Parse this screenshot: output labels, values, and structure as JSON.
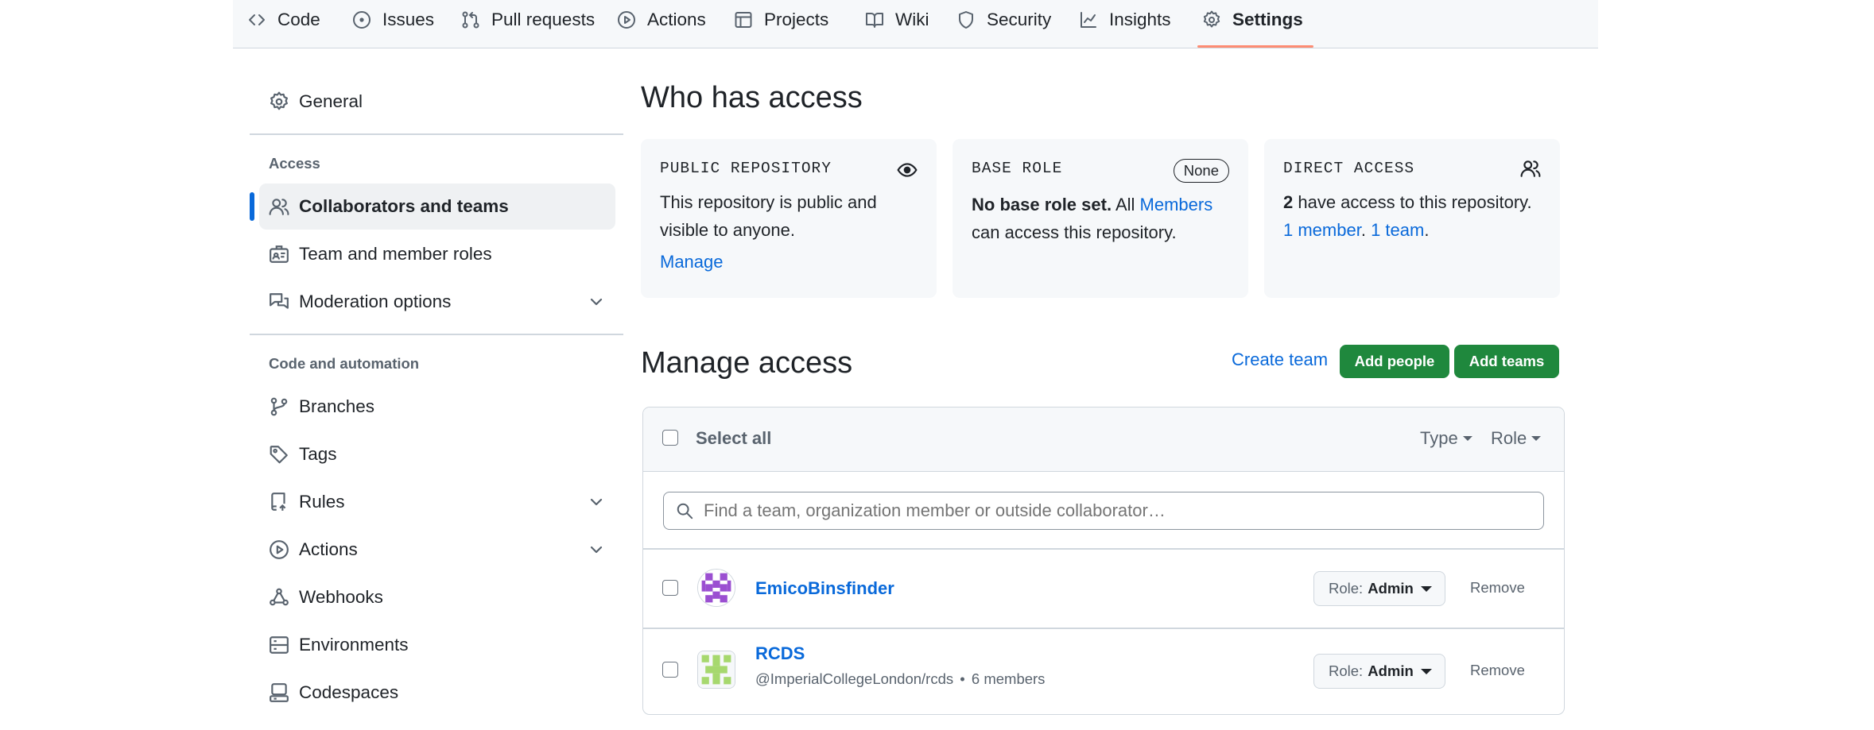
{
  "nav": {
    "items": [
      {
        "label": "Code",
        "icon": "code-icon"
      },
      {
        "label": "Issues",
        "icon": "issue-circle-icon"
      },
      {
        "label": "Pull requests",
        "icon": "pull-request-icon"
      },
      {
        "label": "Actions",
        "icon": "play-icon"
      },
      {
        "label": "Projects",
        "icon": "table-icon"
      },
      {
        "label": "Wiki",
        "icon": "book-icon"
      },
      {
        "label": "Security",
        "icon": "shield-icon"
      },
      {
        "label": "Insights",
        "icon": "graph-icon"
      },
      {
        "label": "Settings",
        "icon": "gear-icon",
        "active": true
      }
    ],
    "accent_color": "#fd8c73"
  },
  "sidebar": {
    "general": "General",
    "access_heading": "Access",
    "access_items": [
      {
        "label": "Collaborators and teams",
        "icon": "people-icon",
        "active": true
      },
      {
        "label": "Team and member roles",
        "icon": "id-badge-icon"
      },
      {
        "label": "Moderation options",
        "icon": "comment-discussion-icon",
        "expandable": true
      }
    ],
    "code_heading": "Code and automation",
    "code_items": [
      {
        "label": "Branches",
        "icon": "git-branch-icon"
      },
      {
        "label": "Tags",
        "icon": "tag-icon"
      },
      {
        "label": "Rules",
        "icon": "repo-push-icon",
        "expandable": true
      },
      {
        "label": "Actions",
        "icon": "play-icon",
        "expandable": true
      },
      {
        "label": "Webhooks",
        "icon": "webhook-icon"
      },
      {
        "label": "Environments",
        "icon": "server-icon"
      },
      {
        "label": "Codespaces",
        "icon": "codespaces-icon"
      }
    ]
  },
  "who_has_access": {
    "heading": "Who has access",
    "public_card": {
      "title": "PUBLIC REPOSITORY",
      "text": "This repository is public and visible to anyone.",
      "manage_link": "Manage"
    },
    "base_role_card": {
      "title": "BASE ROLE",
      "badge": "None",
      "bold": "No base role set.",
      "pre": " All ",
      "link": "Members",
      "post": " can access this repository."
    },
    "direct_card": {
      "title": "DIRECT ACCESS",
      "count": "2",
      "text": " have access to this repository.",
      "member_link": "1 member",
      "sep": ". ",
      "team_link": "1 team",
      "end": "."
    }
  },
  "manage_access": {
    "heading": "Manage access",
    "create_team": "Create team",
    "add_people": "Add people",
    "add_teams": "Add teams",
    "select_all": "Select all",
    "type_filter": "Type",
    "role_filter": "Role",
    "search_placeholder": "Find a team, organization member or outside collaborator…",
    "rows": [
      {
        "name": "EmicoBinsfinder",
        "role_key": "Role:",
        "role_value": "Admin",
        "remove": "Remove"
      },
      {
        "name": "RCDS",
        "sub": "@ImperialCollegeLondon/rcds",
        "dot": "•",
        "members": "6 members",
        "role_key": "Role:",
        "role_value": "Admin",
        "remove": "Remove"
      }
    ],
    "link_color": "#0969da",
    "button_color": "#1f883d"
  }
}
